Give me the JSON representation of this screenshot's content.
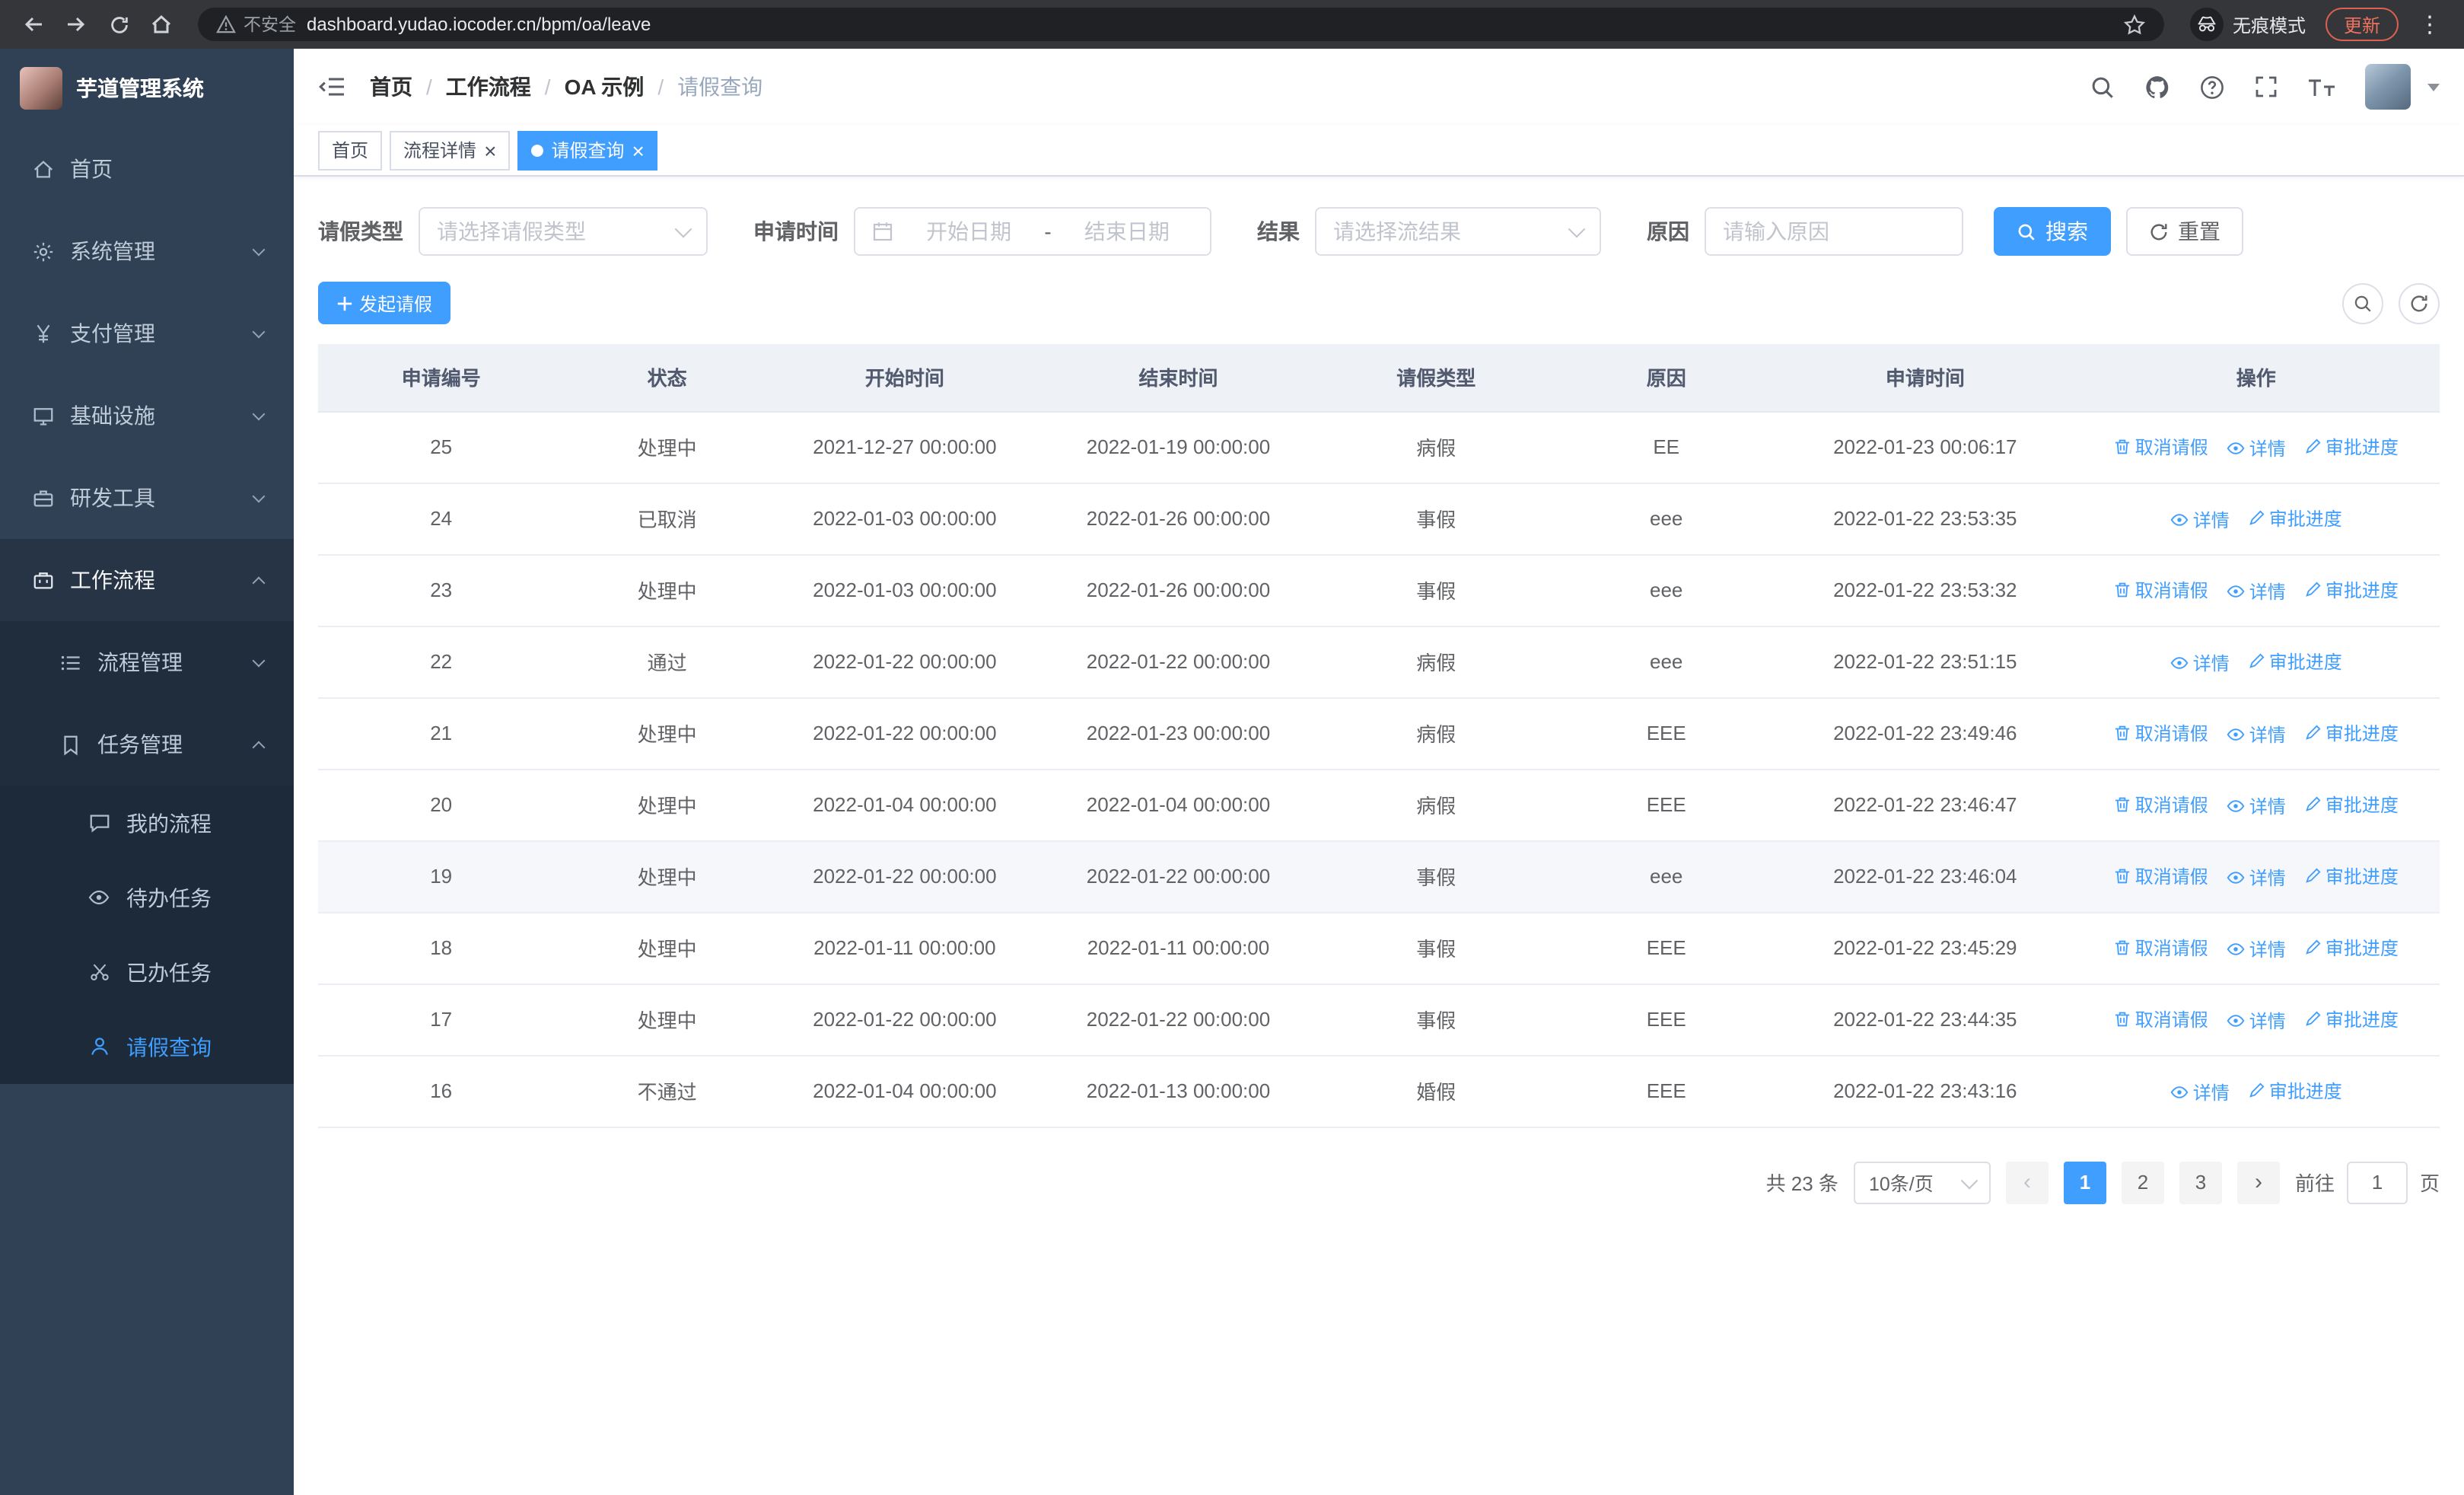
{
  "browser": {
    "security_label": "不安全",
    "url": "dashboard.yudao.iocoder.cn/bpm/oa/leave",
    "incognito_label": "无痕模式",
    "update_label": "更新"
  },
  "sidebar": {
    "title": "芋道管理系统",
    "items": [
      {
        "name": "sidebar-item-home",
        "label": "首页",
        "icon": "home-icon",
        "level": 1
      },
      {
        "name": "sidebar-item-system",
        "label": "系统管理",
        "icon": "gear-icon",
        "level": 1,
        "arrow": "down"
      },
      {
        "name": "sidebar-item-payment",
        "label": "支付管理",
        "icon": "yen-icon",
        "level": 1,
        "arrow": "down"
      },
      {
        "name": "sidebar-item-infrastructure",
        "label": "基础设施",
        "icon": "monitor-icon",
        "level": 1,
        "arrow": "down"
      },
      {
        "name": "sidebar-item-dev-tools",
        "label": "研发工具",
        "icon": "toolbox-icon",
        "level": 1,
        "arrow": "down"
      },
      {
        "name": "sidebar-item-workflow",
        "label": "工作流程",
        "icon": "briefcase-icon",
        "level": 1,
        "arrow": "up",
        "open": true
      },
      {
        "name": "sidebar-item-process-management",
        "label": "流程管理",
        "icon": "list-icon",
        "level": 2,
        "arrow": "down"
      },
      {
        "name": "sidebar-item-task-management",
        "label": "任务管理",
        "icon": "task-icon",
        "level": 2,
        "arrow": "up",
        "open": true
      },
      {
        "name": "sidebar-item-my-process",
        "label": "我的流程",
        "icon": "chat-icon",
        "level": 3
      },
      {
        "name": "sidebar-item-todo-tasks",
        "label": "待办任务",
        "icon": "eye-icon",
        "level": 3
      },
      {
        "name": "sidebar-item-done-tasks",
        "label": "已办任务",
        "icon": "scissors-icon",
        "level": 3
      },
      {
        "name": "sidebar-item-leave-query",
        "label": "请假查询",
        "icon": "user-icon",
        "level": 3,
        "active": true
      }
    ]
  },
  "header": {
    "breadcrumb": [
      "首页",
      "工作流程",
      "OA 示例",
      "请假查询"
    ]
  },
  "tabs": [
    {
      "name": "tab-home",
      "label": "首页",
      "closable": false,
      "active": false
    },
    {
      "name": "tab-process-detail",
      "label": "流程详情",
      "closable": true,
      "active": false
    },
    {
      "name": "tab-leave-query",
      "label": "请假查询",
      "closable": true,
      "active": true
    }
  ],
  "filters": {
    "leave_type_label": "请假类型",
    "leave_type_placeholder": "请选择请假类型",
    "apply_time_label": "申请时间",
    "date_start_placeholder": "开始日期",
    "date_separator": "-",
    "date_end_placeholder": "结束日期",
    "result_label": "结果",
    "result_placeholder": "请选择流结果",
    "reason_label": "原因",
    "reason_placeholder": "请输入原因",
    "search_button": "搜索",
    "reset_button": "重置"
  },
  "toolbar": {
    "create_button": "发起请假"
  },
  "table": {
    "columns": [
      "申请编号",
      "状态",
      "开始时间",
      "结束时间",
      "请假类型",
      "原因",
      "申请时间",
      "操作"
    ],
    "actions": {
      "cancel": "取消请假",
      "detail": "详情",
      "progress": "审批进度"
    },
    "rows": [
      {
        "id": "25",
        "status": "处理中",
        "start": "2021-12-27 00:00:00",
        "end": "2022-01-19 00:00:00",
        "type": "病假",
        "reason": "EE",
        "apply_time": "2022-01-23 00:06:17",
        "can_cancel": true,
        "highlighted": false
      },
      {
        "id": "24",
        "status": "已取消",
        "start": "2022-01-03 00:00:00",
        "end": "2022-01-26 00:00:00",
        "type": "事假",
        "reason": "eee",
        "apply_time": "2022-01-22 23:53:35",
        "can_cancel": false,
        "highlighted": false
      },
      {
        "id": "23",
        "status": "处理中",
        "start": "2022-01-03 00:00:00",
        "end": "2022-01-26 00:00:00",
        "type": "事假",
        "reason": "eee",
        "apply_time": "2022-01-22 23:53:32",
        "can_cancel": true,
        "highlighted": false
      },
      {
        "id": "22",
        "status": "通过",
        "start": "2022-01-22 00:00:00",
        "end": "2022-01-22 00:00:00",
        "type": "病假",
        "reason": "eee",
        "apply_time": "2022-01-22 23:51:15",
        "can_cancel": false,
        "highlighted": false
      },
      {
        "id": "21",
        "status": "处理中",
        "start": "2022-01-22 00:00:00",
        "end": "2022-01-23 00:00:00",
        "type": "病假",
        "reason": "EEE",
        "apply_time": "2022-01-22 23:49:46",
        "can_cancel": true,
        "highlighted": false
      },
      {
        "id": "20",
        "status": "处理中",
        "start": "2022-01-04 00:00:00",
        "end": "2022-01-04 00:00:00",
        "type": "病假",
        "reason": "EEE",
        "apply_time": "2022-01-22 23:46:47",
        "can_cancel": true,
        "highlighted": false
      },
      {
        "id": "19",
        "status": "处理中",
        "start": "2022-01-22 00:00:00",
        "end": "2022-01-22 00:00:00",
        "type": "事假",
        "reason": "eee",
        "apply_time": "2022-01-22 23:46:04",
        "can_cancel": true,
        "highlighted": true
      },
      {
        "id": "18",
        "status": "处理中",
        "start": "2022-01-11 00:00:00",
        "end": "2022-01-11 00:00:00",
        "type": "事假",
        "reason": "EEE",
        "apply_time": "2022-01-22 23:45:29",
        "can_cancel": true,
        "highlighted": false
      },
      {
        "id": "17",
        "status": "处理中",
        "start": "2022-01-22 00:00:00",
        "end": "2022-01-22 00:00:00",
        "type": "事假",
        "reason": "EEE",
        "apply_time": "2022-01-22 23:44:35",
        "can_cancel": true,
        "highlighted": false
      },
      {
        "id": "16",
        "status": "不通过",
        "start": "2022-01-04 00:00:00",
        "end": "2022-01-13 00:00:00",
        "type": "婚假",
        "reason": "EEE",
        "apply_time": "2022-01-22 23:43:16",
        "can_cancel": false,
        "highlighted": false
      }
    ]
  },
  "pagination": {
    "total_label": "共 23 条",
    "page_size": "10条/页",
    "pages": [
      {
        "label": "1",
        "active": true
      },
      {
        "label": "2",
        "active": false
      },
      {
        "label": "3",
        "active": false
      }
    ],
    "goto_label": "前往",
    "goto_value": "1",
    "goto_suffix": "页"
  },
  "colors": {
    "primary": "#409eff",
    "link": "#409eff",
    "sidebar_bg": "#304156",
    "submenu_bg": "#1f2d3d",
    "table_header_bg": "#eef1f6",
    "chrome_bg": "#35363a",
    "update_accent": "#e0604f"
  }
}
